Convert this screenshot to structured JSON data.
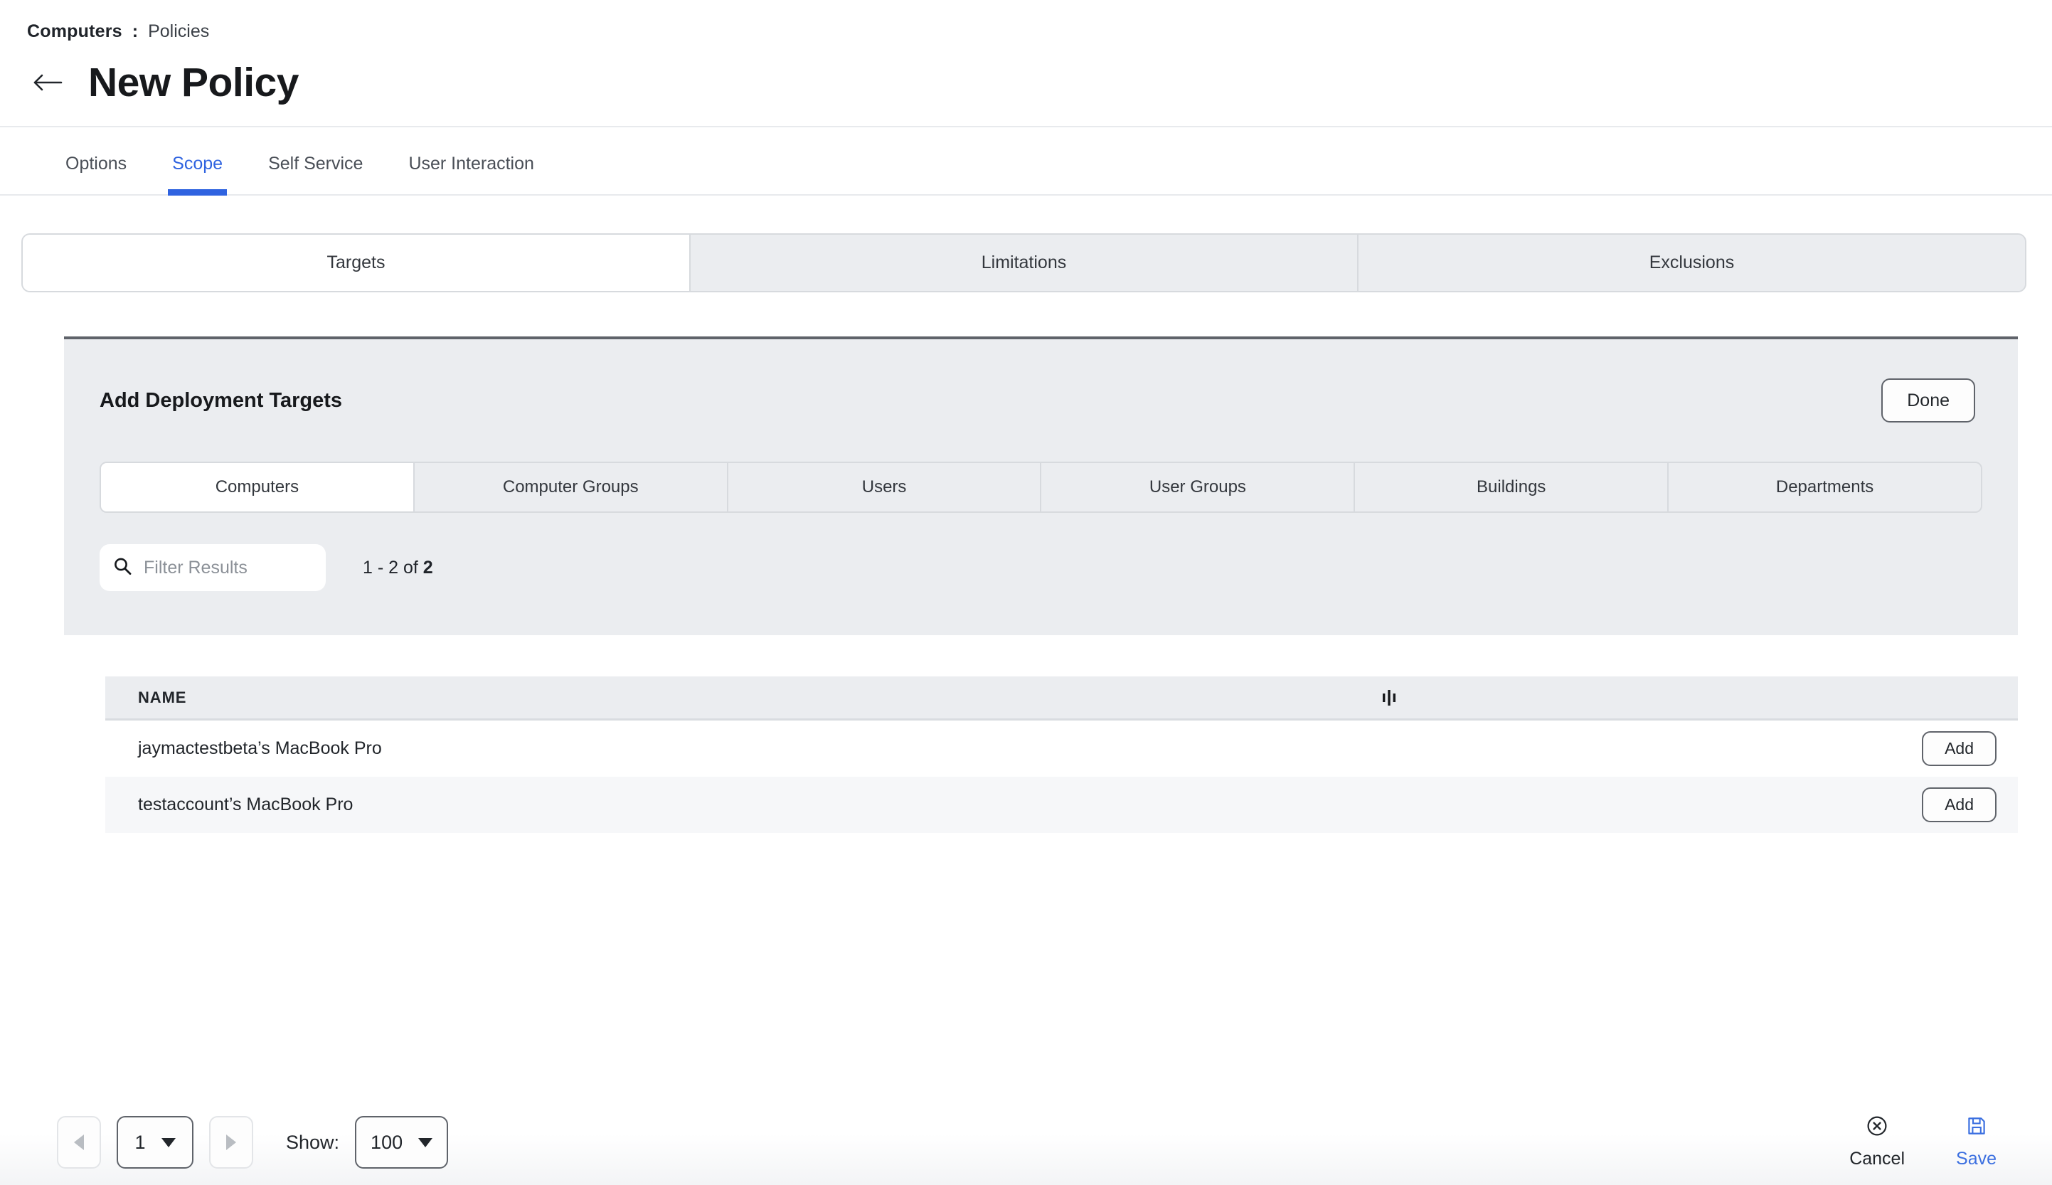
{
  "breadcrumb": {
    "current": "Computers",
    "separator": ":",
    "link": "Policies"
  },
  "header": {
    "title": "New Policy",
    "back_icon": "arrow-left-icon"
  },
  "tabs": [
    {
      "label": "Options",
      "active": false
    },
    {
      "label": "Scope",
      "active": true
    },
    {
      "label": "Self Service",
      "active": false
    },
    {
      "label": "User Interaction",
      "active": false
    }
  ],
  "scope_segments": [
    {
      "label": "Targets",
      "active": true
    },
    {
      "label": "Limitations",
      "active": false
    },
    {
      "label": "Exclusions",
      "active": false
    }
  ],
  "panel": {
    "title": "Add Deployment Targets",
    "done_label": "Done",
    "tabs": [
      {
        "label": "Computers",
        "active": true
      },
      {
        "label": "Computer Groups",
        "active": false
      },
      {
        "label": "Users",
        "active": false
      },
      {
        "label": "User Groups",
        "active": false
      },
      {
        "label": "Buildings",
        "active": false
      },
      {
        "label": "Departments",
        "active": false
      }
    ],
    "search": {
      "placeholder": "Filter Results",
      "value": "",
      "icon": "search-icon"
    },
    "result_count": {
      "range": "1 - 2 of ",
      "total": "2"
    }
  },
  "table": {
    "columns": [
      "NAME"
    ],
    "resize_icon": "column-resize-icon",
    "rows": [
      {
        "name": "jaymactestbeta’s MacBook Pro",
        "action_label": "Add"
      },
      {
        "name": "testaccount’s MacBook Pro",
        "action_label": "Add"
      }
    ]
  },
  "footer": {
    "prev_icon": "triangle-left-icon",
    "next_icon": "triangle-right-icon",
    "page_value": "1",
    "show_label": "Show:",
    "page_size_value": "100",
    "cancel_label": "Cancel",
    "cancel_icon": "circle-x-icon",
    "save_label": "Save",
    "save_icon": "floppy-disk-icon"
  },
  "colors": {
    "accent_blue": "#2f63e0",
    "save_blue": "#3b6fe0",
    "panel_gray": "#ebedf0",
    "row_alt": "#f6f7f9",
    "border_dark": "#5f636a"
  }
}
